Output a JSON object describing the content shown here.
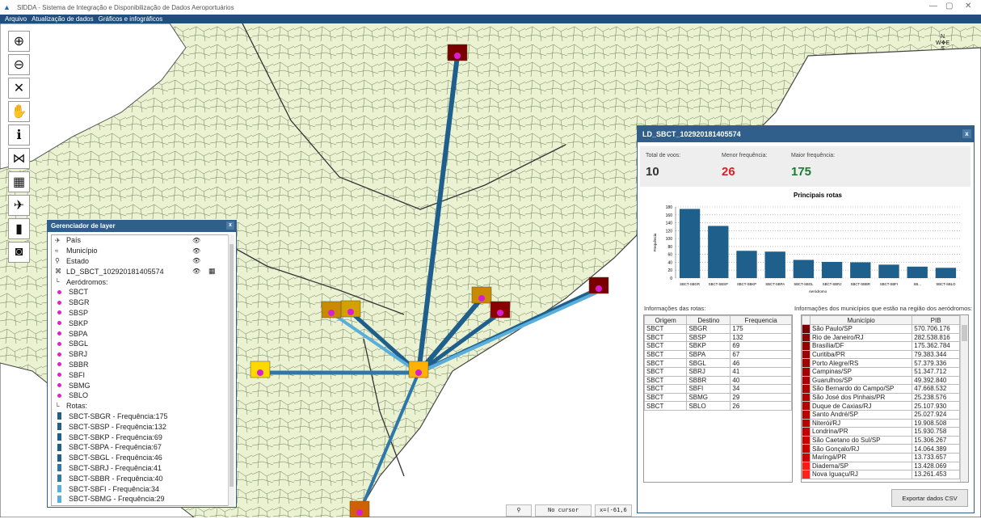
{
  "window": {
    "title": "SIDDA - Sistema de Integração e Disponibilização de Dados Aeroportuários"
  },
  "menu": [
    "Arquivo",
    "Atualização de dados",
    "Gráficos e infográficos"
  ],
  "tools": [
    {
      "name": "zoom-in-icon",
      "glyph": "⊕"
    },
    {
      "name": "zoom-out-icon",
      "glyph": "⊖"
    },
    {
      "name": "full-extent-icon",
      "glyph": "✕"
    },
    {
      "name": "pan-hand-icon",
      "glyph": "✋"
    },
    {
      "name": "info-icon",
      "glyph": "ℹ"
    },
    {
      "name": "network-icon",
      "glyph": "⋈"
    },
    {
      "name": "table-icon",
      "glyph": "▦"
    },
    {
      "name": "airplane-icon",
      "glyph": "✈"
    },
    {
      "name": "statistics-icon",
      "glyph": "▮"
    },
    {
      "name": "camera-icon",
      "glyph": "◙"
    }
  ],
  "compass": {
    "n": "N",
    "s": "S",
    "e": "E",
    "w": "W"
  },
  "layer_manager": {
    "title": "Gerenciador de layer",
    "layers": [
      {
        "label": "País",
        "icon": "✈",
        "eye": true
      },
      {
        "label": "Município",
        "icon": "≈",
        "eye": true
      },
      {
        "label": "Estado",
        "icon": "⚲",
        "eye": true
      },
      {
        "label": "LD_SBCT_102920181405574",
        "icon": "⌘",
        "eye": true,
        "table": true
      }
    ],
    "aero_header": "Aeródromos:",
    "aerodromes": [
      "SBCT",
      "SBGR",
      "SBSP",
      "SBKP",
      "SBPA",
      "SBGL",
      "SBRJ",
      "SBBR",
      "SBFI",
      "SBMG",
      "SBLO"
    ],
    "routes_header": "Rotas:",
    "routes": [
      {
        "label": "SBCT-SBGR - Frequência:175",
        "color": "#1f5f8b"
      },
      {
        "label": "SBCT-SBSP - Frequência:132",
        "color": "#1f5f8b"
      },
      {
        "label": "SBCT-SBKP - Frequência:69",
        "color": "#1f5f8b"
      },
      {
        "label": "SBCT-SBPA - Frequência:67",
        "color": "#1f5f8b"
      },
      {
        "label": "SBCT-SBGL - Frequência:46",
        "color": "#1f5f8b"
      },
      {
        "label": "SBCT-SBRJ - Frequência:41",
        "color": "#2e77a8"
      },
      {
        "label": "SBCT-SBBR - Frequência:40",
        "color": "#2e77a8"
      },
      {
        "label": "SBCT-SBFI - Frequência:34",
        "color": "#5aaedc"
      },
      {
        "label": "SBCT-SBMG - Frequência:29",
        "color": "#5aaedc"
      }
    ]
  },
  "stats": {
    "title": "LD_SBCT_102920181405574",
    "total_label": "Total de voos:",
    "total_value": "10",
    "min_label": "Menor frequência:",
    "min_value": "26",
    "min_color": "#d81f2a",
    "max_label": "Maior frequência:",
    "max_value": "175",
    "max_color": "#1e7a2e",
    "routes_info_label": "Informações das rotas:",
    "muni_info_label": "Informações dos municípios que estão na região dos aeródromos:",
    "route_cols": [
      "Origem",
      "Destino",
      "Frequencia"
    ],
    "route_rows": [
      [
        "SBCT",
        "SBGR",
        "175"
      ],
      [
        "SBCT",
        "SBSP",
        "132"
      ],
      [
        "SBCT",
        "SBKP",
        "69"
      ],
      [
        "SBCT",
        "SBPA",
        "67"
      ],
      [
        "SBCT",
        "SBGL",
        "46"
      ],
      [
        "SBCT",
        "SBRJ",
        "41"
      ],
      [
        "SBCT",
        "SBBR",
        "40"
      ],
      [
        "SBCT",
        "SBFI",
        "34"
      ],
      [
        "SBCT",
        "SBMG",
        "29"
      ],
      [
        "SBCT",
        "SBLO",
        "26"
      ]
    ],
    "muni_cols": [
      "Município",
      "PIB"
    ],
    "muni_rows": [
      [
        "São Paulo/SP",
        "570.706.176",
        "#7a0000"
      ],
      [
        "Rio de Janeiro/RJ",
        "282.538.816",
        "#8b0000"
      ],
      [
        "Brasília/DF",
        "175.362.784",
        "#920000"
      ],
      [
        "Curitiba/PR",
        "79.383.344",
        "#9a0000"
      ],
      [
        "Porto Alegre/RS",
        "57.379.336",
        "#a00000"
      ],
      [
        "Campinas/SP",
        "51.347.712",
        "#a30000"
      ],
      [
        "Guarulhos/SP",
        "49.392.840",
        "#a80000"
      ],
      [
        "São Bernardo do Campo/SP",
        "47.668.532",
        "#aa0000"
      ],
      [
        "São José dos Pinhais/PR",
        "25.238.576",
        "#b00000"
      ],
      [
        "Duque de Caxias/RJ",
        "25.107.930",
        "#b30000"
      ],
      [
        "Santo André/SP",
        "25.027.924",
        "#b60000"
      ],
      [
        "Niterói/RJ",
        "19.908.508",
        "#bb0000"
      ],
      [
        "Londrina/PR",
        "15.930.758",
        "#c00000"
      ],
      [
        "São Caetano do Sul/SP",
        "15.306.267",
        "#c40000"
      ],
      [
        "São Gonçalo/RJ",
        "14.064.389",
        "#c80000"
      ],
      [
        "Maringá/PR",
        "13.733.657",
        "#d00000"
      ],
      [
        "Diadema/SP",
        "13.428.069",
        "#ff1a1a"
      ],
      [
        "Nova Iguaçu/RJ",
        "13.261.453",
        "#ff2020"
      ]
    ],
    "export_label": "Exportar dados CSV"
  },
  "chart_data": {
    "type": "bar",
    "title": "Principais rotas",
    "xlabel": "Aeródromo",
    "ylabel": "Frequência",
    "categories": [
      "SBCT-SBGR",
      "SBCT-SBSP",
      "SBCT-SBKP",
      "SBCT-SBPA",
      "SBCT-SBGL",
      "SBCT-SBRJ",
      "SBCT-SBBR",
      "SBCT-SBFI",
      "SB...",
      "SBCT-SBLO"
    ],
    "values": [
      175,
      132,
      69,
      67,
      46,
      41,
      40,
      34,
      29,
      26
    ],
    "ylim": [
      0,
      180
    ],
    "yticks": [
      0,
      20,
      40,
      60,
      80,
      100,
      120,
      140,
      160,
      180
    ],
    "grid": true,
    "color": "#1f5f8b"
  },
  "status": {
    "cursor_text": "No cursor",
    "coords_text": "x=(-61,6"
  }
}
